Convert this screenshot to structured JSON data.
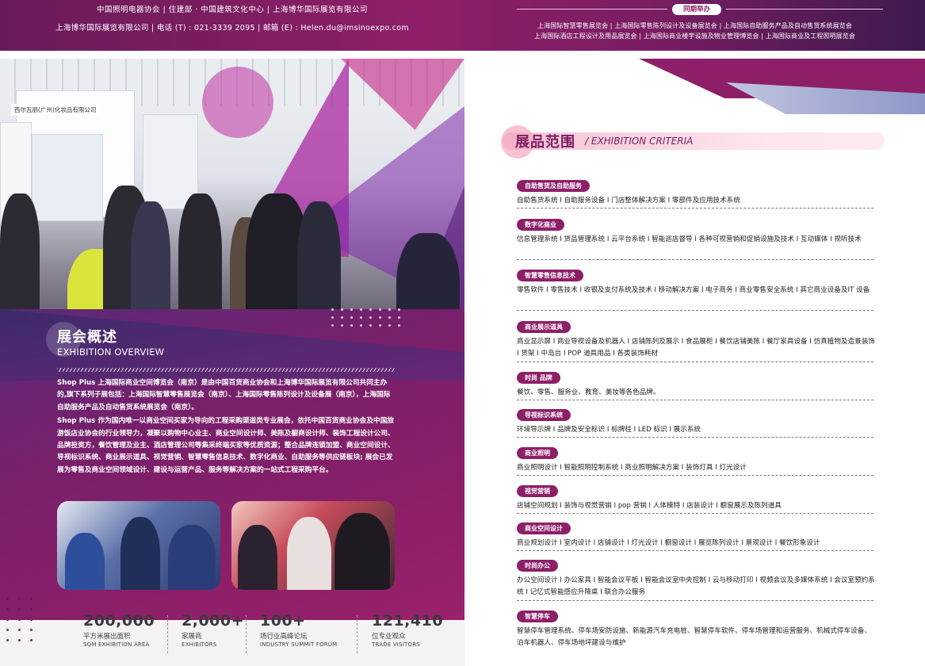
{
  "header": {
    "organizers": "中国照明电器协会 | 住建部 · 中国建筑文化中心 | 上海博华国际展览有限公司",
    "contact": "上海博华国际展览有限公司 | 电话 (T) : 021-3339 2095 | 邮箱 (E) : Helen.du@imsinoexpo.com",
    "concurrent_label": "同期举办",
    "concurrent_line1": "上海国际智慧零售展览会 | 上海国际零售陈列设计及设备展览会 | 上海国际自助服务产品及自动售货系统展览会",
    "concurrent_line2": "上海国际酒店工程设计及用品展览会 | 上海国际商业楼宇设施及物业管理博览会 | 上海国际商业及工程照明展览会"
  },
  "overview": {
    "photo_sign": "西尔瓦丽(广州)化妆品有限公司",
    "title_zh": "展会概述",
    "title_en": "EXHIBITION OVERVIEW",
    "para1": "Shop Plus 上海国际商业空间博览会（南京）是由中国百货商业协会和上海博华国际展览有限公司共同主办的,旗下系列子展包括：上海国际智慧零售展览会（南京）、上海国际零售陈列设计及设备展（南京），上海国际自助服务产品及自动售货系统展览会（南京）。",
    "para2": "Shop Plus 作为国内唯一以商业空间买家为导向的工程采购渠道类专业展会，依托中国百货商业协会及中国旅游饭店业协会的行业领导力，凝聚以购物中心业主、商业空间设计师、美陈及橱商设计师、装饰工程设计公司、品牌投资方，餐饮管理及业主、酒店管理公司等集采终端买家等优质资源；整合品牌连锁加盟、商业空间设计、导视标识系统、商业展示道具、视觉营销、智慧零售信息技术、数字化商业、自助服务等供应链板块; 展会已发展为零售及商业空间领域设计、建设与运营产品、服务等解决方案的一站式工程采购平台。"
  },
  "stats": [
    {
      "num": "200,000",
      "zh": "平方米展出面积",
      "en": "SQM EXHIBITION AREA"
    },
    {
      "num": "2,000+",
      "zh": "家展商",
      "en": "EXHIBITORS"
    },
    {
      "num": "100+",
      "zh": "场行业高峰论坛",
      "en": "INDUSTRY SUMMIT FORUM"
    },
    {
      "num": "121,410",
      "zh": "位专业观众",
      "en": "TRADE VISITORS"
    }
  ],
  "criteria": {
    "title_zh": "展品范围",
    "title_en": "/ EXHIBITION CRITERIA",
    "categories": [
      {
        "tag": "自助售货及自助服务",
        "items": "自助售货系统 I 自助服务设备 I 门店整体解决方案 I 零部件及应用技术系统"
      },
      {
        "tag": "数字化商业",
        "items": "信息管理系统 I 货品管理系统 I 云平台系统 I 智能巡店督导 I 各种可视营销和促销设施及技术 I 互动媒体 I 视听技术"
      },
      {
        "tag": "智慧零售信息技术",
        "items": "零售软件 I 零售技术 I 收银及支付系统及技术 I 移动解决方案 I 电子商务 I 商业零售安全系统 I 其它商业设备及IT 设备"
      },
      {
        "tag": "商业展示道具",
        "items": "商业显示屏 I 商业导视设备及机器人 I 店铺陈列及展示 I 食品展柜 I 餐饮店铺美陈 I 餐厅家具设备 I 仿真植物及造景装饰 I 货架 I 中岛台 I POP 道具用品 I 各类装饰耗材"
      },
      {
        "tag": "时尚 品牌",
        "items": "餐饮、零售、服务业、教育、美妆等各色品牌。"
      },
      {
        "tag": "导视标识系统",
        "items": "环境导示牌 I 品牌及安全标识 I 标牌柱 I LED 标识 I 展示系统"
      },
      {
        "tag": "商业照明",
        "items": "商业照明设计 I 智能照明控制系统 I 商业照明解决方案 I 装饰灯具 I 灯光设计"
      },
      {
        "tag": "视觉营销",
        "items": "店铺空间规划 I 装饰与视觉营销 I pop 营销 I 人体模特 I 店装设计 I 橱窗展示及陈列道具"
      },
      {
        "tag": "商业空间设计",
        "items": "商业规划设计 I 室内设计 I 店铺设计 I 灯光设计 I 橱窗设计 I 展览陈列设计 I 景观设计 I 餐饮形象设计"
      },
      {
        "tag": "时尚办公",
        "items": "办公空间设计 I 办公家具 I 智能会议平板 I 智能会议室中央控制 I 云与移动打印 I 视频会议及多媒体系统 I 会议室预约系统 I 记忆式智能感应升降桌 I 联合办公服务"
      },
      {
        "tag": "智慧停车",
        "items": "智慧停车管理系统、停车场安防设施、新能源汽车充电桩、智慧停车软件、停车场管理和运营服务、机械式停车设备、泊车机器人、停车场地坪建设与维护"
      }
    ]
  }
}
